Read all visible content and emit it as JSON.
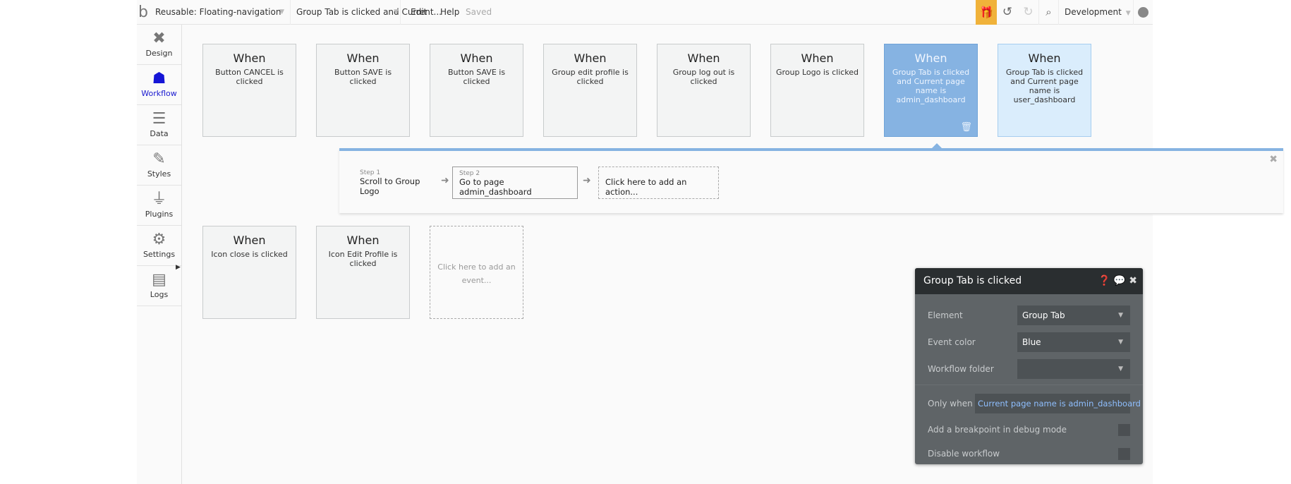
{
  "topbar": {
    "logo": "b",
    "page_selector": "Reusable: Floating-navigation",
    "event_selector": "Group Tab is clicked and Current...",
    "edit": "Edit",
    "help": "Help",
    "status": "Saved",
    "environment": "Development",
    "icons": [
      "gift-icon",
      "undo-icon",
      "redo-icon",
      "search-icon",
      "user-icon"
    ],
    "gift_color": "#f0b23a"
  },
  "sidebar": {
    "items": [
      {
        "label": "Design",
        "icon": "design-icon"
      },
      {
        "label": "Workflow",
        "icon": "workflow-icon",
        "active": true
      },
      {
        "label": "Data",
        "icon": "database-icon"
      },
      {
        "label": "Styles",
        "icon": "brush-icon"
      },
      {
        "label": "Plugins",
        "icon": "plug-icon"
      },
      {
        "label": "Settings",
        "icon": "gear-icon"
      },
      {
        "label": "Logs",
        "icon": "document-icon"
      }
    ]
  },
  "events_row1": [
    {
      "when": "When",
      "text": "Button CANCEL is clicked"
    },
    {
      "when": "When",
      "text": "Button SAVE is clicked"
    },
    {
      "when": "When",
      "text": "Button SAVE is clicked"
    },
    {
      "when": "When",
      "text": "Group edit profile is clicked"
    },
    {
      "when": "When",
      "text": "Group log out is clicked"
    },
    {
      "when": "When",
      "text": "Group Logo is clicked"
    },
    {
      "when": "When",
      "text": "Group Tab is clicked and Current page name is admin_dashboard",
      "selected": true
    },
    {
      "when": "When",
      "text": "Group Tab is clicked and Current page name is user_dashboard"
    }
  ],
  "steps": [
    {
      "label": "Step 1",
      "text": "Scroll to Group Logo"
    },
    {
      "label": "Step 2",
      "text": "Go to page admin_dashboard"
    }
  ],
  "add_action": "Click here to add an action...",
  "events_row2": [
    {
      "when": "When",
      "text": "Icon close is clicked"
    },
    {
      "when": "When",
      "text": "Icon Edit Profile is clicked"
    }
  ],
  "add_event": "Click here to add an event...",
  "panel": {
    "title": "Group Tab is clicked",
    "element_label": "Element",
    "element_value": "Group Tab",
    "color_label": "Event color",
    "color_value": "Blue",
    "folder_label": "Workflow folder",
    "folder_value": "",
    "only_when_label": "Only when",
    "only_when_value": "Current page name is admin_dashboard",
    "breakpoint_label": "Add a breakpoint in debug mode",
    "disable_label": "Disable workflow"
  },
  "colors": {
    "selected_event": "#86b3e2",
    "light_event": "#daedfc",
    "panel_bg": "#5f6467",
    "panel_header": "#2a2e30",
    "workflow_active": "#1515d6"
  }
}
